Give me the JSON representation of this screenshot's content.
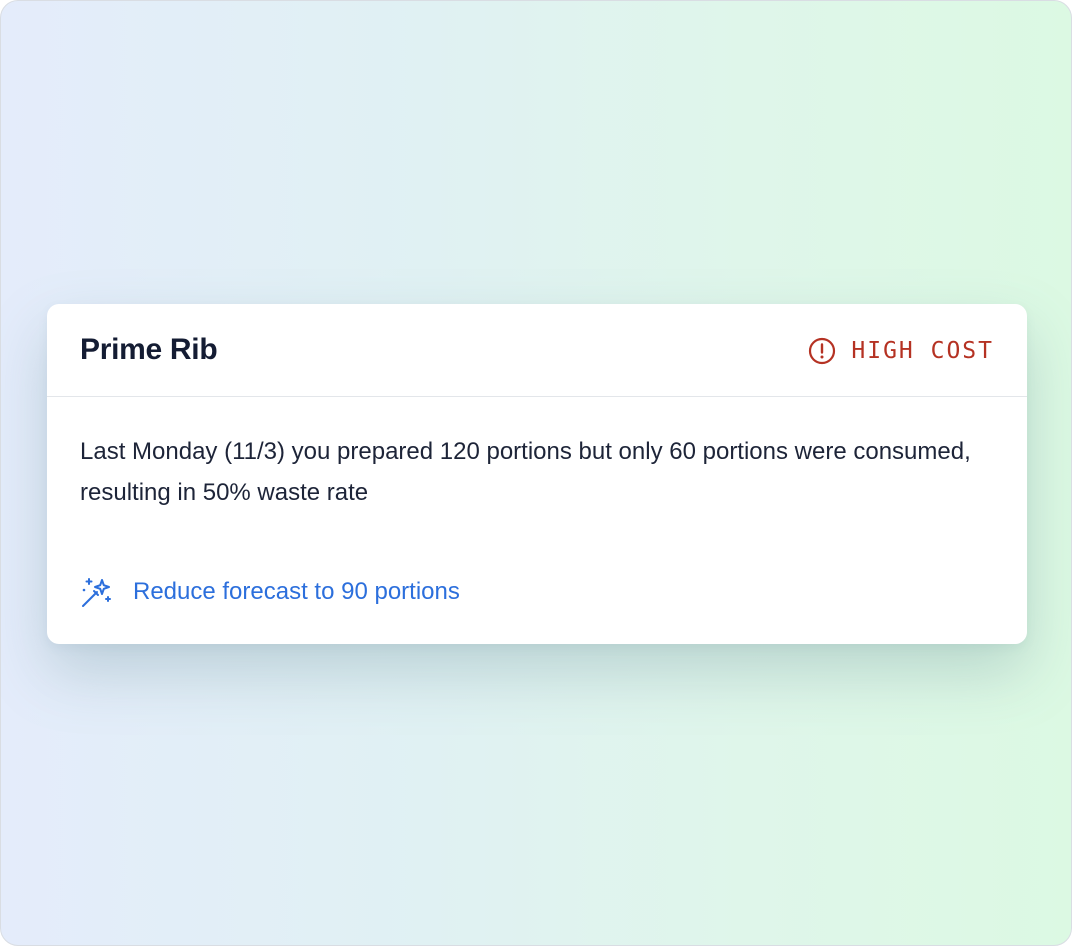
{
  "card": {
    "title": "Prime Rib",
    "badge": {
      "label": "HIGH COST",
      "icon": "alert-circle-icon",
      "color": "#b53223"
    },
    "message": "Last Monday (11/3) you prepared 120 portions but only 60 portions were consumed, resulting in 50% waste rate",
    "action": {
      "label": "Reduce forecast to 90 portions",
      "icon": "magic-wand-icon",
      "color": "#2c6fdc"
    }
  }
}
